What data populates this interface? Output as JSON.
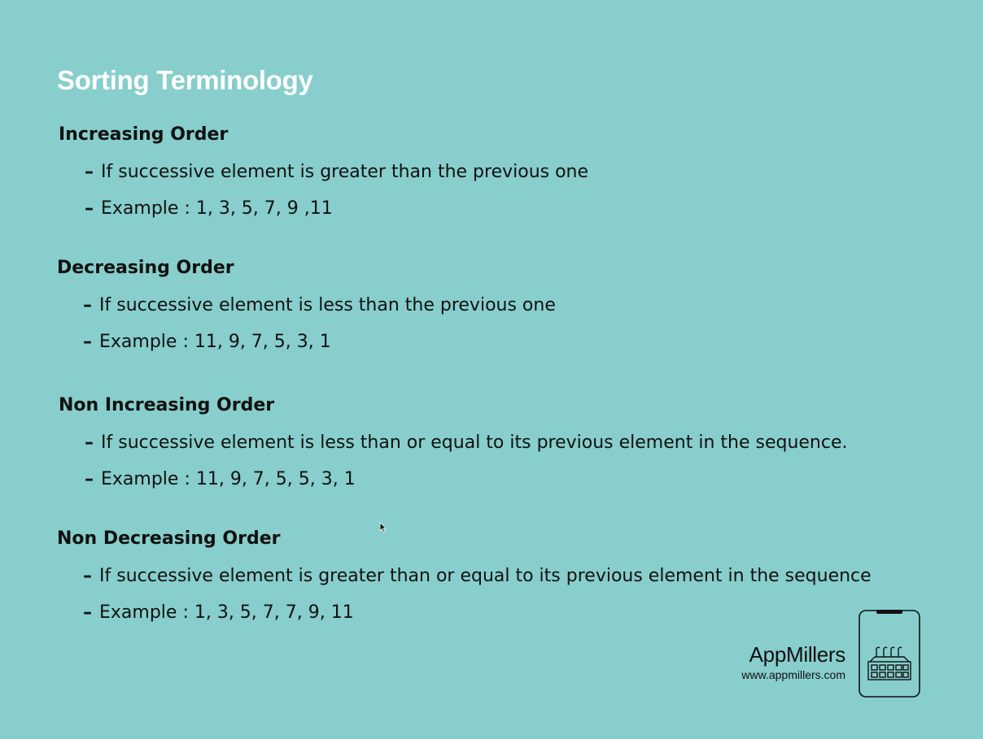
{
  "slide": {
    "title": "Sorting Terminology",
    "sections": [
      {
        "heading": "Increasing Order",
        "definition": "If successive element is greater than the previous one",
        "example": "Example : 1, 3, 5, 7, 9 ,11"
      },
      {
        "heading": "Decreasing Order",
        "definition": "If successive element is less than the previous one",
        "example": "Example : 11, 9, 7, 5, 3, 1"
      },
      {
        "heading": "Non Increasing Order",
        "definition": "If successive element is less than or equal to its previous element in the sequence.",
        "example": "Example : 11, 9, 7, 5, 5, 3, 1"
      },
      {
        "heading": "Non Decreasing Order",
        "definition": "If successive element is greater than or equal to its previous element in the sequence",
        "example": "Example : 1, 3, 5, 7, 7, 9, 11"
      }
    ],
    "bullet_glyph": "–"
  },
  "brand": {
    "name": "AppMillers",
    "url": "www.appmillers.com",
    "logo_icon": "phone-factory-icon"
  },
  "colors": {
    "background": "#87cecc",
    "title": "#ffffff",
    "text": "#111111"
  }
}
